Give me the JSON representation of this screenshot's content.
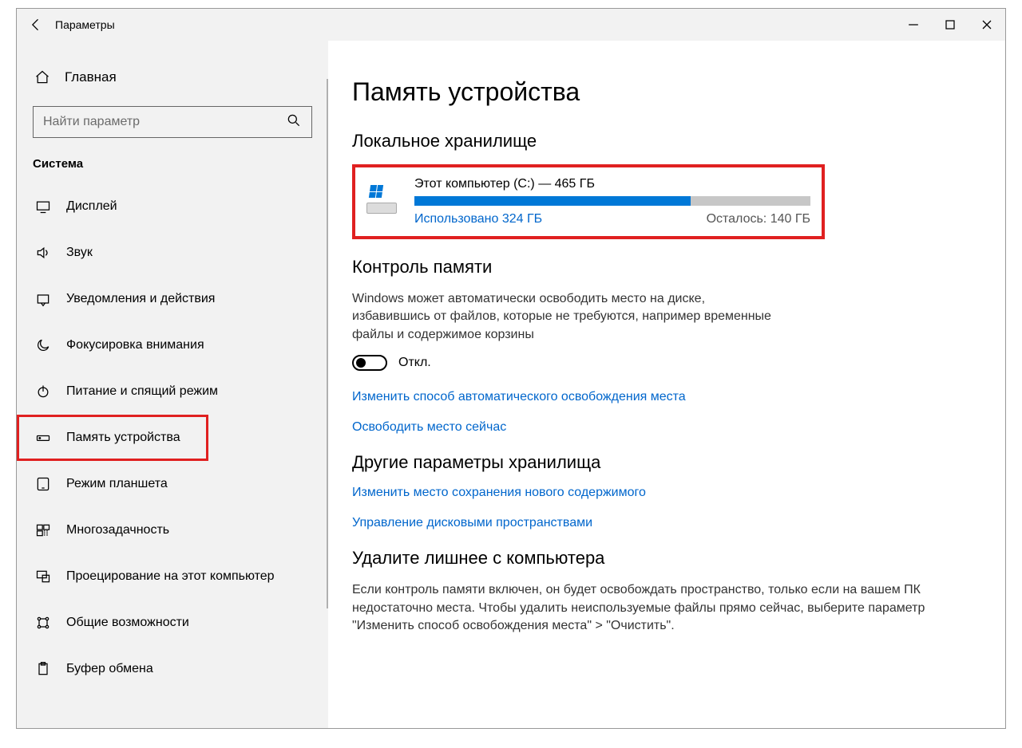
{
  "window": {
    "title": "Параметры"
  },
  "sidebar": {
    "home": "Главная",
    "search_placeholder": "Найти параметр",
    "section": "Система",
    "items": [
      {
        "id": "display",
        "label": "Дисплей"
      },
      {
        "id": "sound",
        "label": "Звук"
      },
      {
        "id": "notifications",
        "label": "Уведомления и действия"
      },
      {
        "id": "focus",
        "label": "Фокусировка внимания"
      },
      {
        "id": "power",
        "label": "Питание и спящий режим"
      },
      {
        "id": "storage",
        "label": "Память устройства",
        "highlighted": true
      },
      {
        "id": "tablet",
        "label": "Режим планшета"
      },
      {
        "id": "multitask",
        "label": "Многозадачность"
      },
      {
        "id": "projecting",
        "label": "Проецирование на этот компьютер"
      },
      {
        "id": "shared",
        "label": "Общие возможности"
      },
      {
        "id": "clipboard",
        "label": "Буфер обмена"
      }
    ]
  },
  "main": {
    "title": "Память устройства",
    "local_storage_heading": "Локальное хранилище",
    "drive": {
      "label": "Этот компьютер (C:) — 465 ГБ",
      "used_text": "Использовано 324 ГБ",
      "free_text": "Осталось: 140 ГБ",
      "used_percent": 69.7
    },
    "sense_heading": "Контроль памяти",
    "sense_desc": "Windows может автоматически освободить место на диске, избавившись от файлов, которые не требуются, например временные файлы и содержимое корзины",
    "toggle_state": "Откл.",
    "link_configure": "Изменить способ автоматического освобождения места",
    "link_free_now": "Освободить место сейчас",
    "more_heading": "Другие параметры хранилища",
    "link_change_save": "Изменить место сохранения нового содержимого",
    "link_manage_spaces": "Управление дисковыми пространствами",
    "cleanup_heading": "Удалите лишнее с компьютера",
    "cleanup_desc": "Если контроль памяти включен, он будет освобождать пространство, только если на вашем ПК недостаточно места. Чтобы удалить неиспользуемые файлы прямо сейчас, выберите параметр \"Изменить способ освобождения места\" > \"Очистить\"."
  }
}
